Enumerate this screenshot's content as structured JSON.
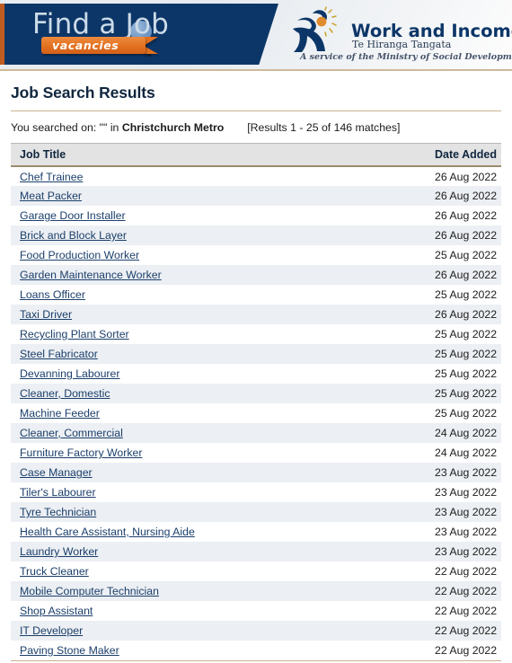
{
  "header": {
    "brand_left": {
      "wordmark": "Find a Job",
      "ribbon_label": "vacancies",
      "magnifier_icon": "magnifier-icon"
    },
    "brand_right": {
      "title": "Work and Income",
      "subtitle": "Te Hiranga Tangata",
      "tagline": "A service of the Ministry of Social Development",
      "logo_icon": "running-figure-sun-icon"
    },
    "colors": {
      "navy": "#0d3668",
      "orange": "#e2701f",
      "tan_rule": "#c9b293",
      "table_header_bg": "#e3e3e3",
      "row_alt_bg": "#eceff3",
      "link": "#1b3f6b"
    }
  },
  "main": {
    "page_title": "Job Search Results",
    "search_summary": {
      "prefix": "You searched on: \"\" in ",
      "location": "Christchurch Metro",
      "results_range": "[Results 1 - 25 of 146 matches]"
    },
    "table": {
      "columns": [
        "Job Title",
        "Date Added"
      ],
      "rows": [
        {
          "title": "Chef Trainee",
          "date": "26 Aug 2022"
        },
        {
          "title": "Meat Packer",
          "date": "26 Aug 2022"
        },
        {
          "title": "Garage Door Installer",
          "date": "26 Aug 2022"
        },
        {
          "title": "Brick and Block Layer",
          "date": "26 Aug 2022"
        },
        {
          "title": "Food Production Worker",
          "date": "25 Aug 2022"
        },
        {
          "title": "Garden Maintenance Worker",
          "date": "26 Aug 2022"
        },
        {
          "title": "Loans Officer",
          "date": "25 Aug 2022"
        },
        {
          "title": "Taxi Driver",
          "date": "26 Aug 2022"
        },
        {
          "title": "Recycling Plant Sorter",
          "date": "25 Aug 2022"
        },
        {
          "title": "Steel Fabricator",
          "date": "25 Aug 2022"
        },
        {
          "title": "Devanning Labourer",
          "date": "25 Aug 2022"
        },
        {
          "title": "Cleaner, Domestic",
          "date": "25 Aug 2022"
        },
        {
          "title": "Machine Feeder",
          "date": "25 Aug 2022"
        },
        {
          "title": "Cleaner, Commercial",
          "date": "24 Aug 2022"
        },
        {
          "title": "Furniture Factory Worker",
          "date": "24 Aug 2022"
        },
        {
          "title": "Case Manager",
          "date": "23 Aug 2022"
        },
        {
          "title": "Tiler's Labourer",
          "date": "23 Aug 2022"
        },
        {
          "title": "Tyre Technician",
          "date": "23 Aug 2022"
        },
        {
          "title": "Health Care Assistant, Nursing Aide",
          "date": "23 Aug 2022"
        },
        {
          "title": "Laundry Worker",
          "date": "23 Aug 2022"
        },
        {
          "title": "Truck Cleaner",
          "date": "22 Aug 2022"
        },
        {
          "title": "Mobile Computer Technician",
          "date": "22 Aug 2022"
        },
        {
          "title": "Shop Assistant",
          "date": "22 Aug 2022"
        },
        {
          "title": "IT Developer",
          "date": "22 Aug 2022"
        },
        {
          "title": "Paving Stone Maker",
          "date": "22 Aug 2022"
        }
      ]
    }
  }
}
